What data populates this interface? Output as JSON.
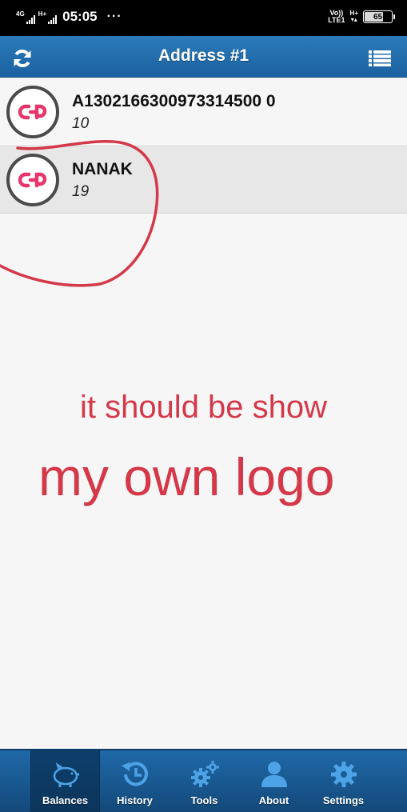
{
  "status_bar": {
    "network_1": "4G",
    "network_2": "H+",
    "time": "05:05",
    "more": "···",
    "volte_1": "Vo))",
    "volte_2": "LTE1",
    "data_type": "H+",
    "battery_percent": "65"
  },
  "header": {
    "title": "Address #1",
    "left_icon": "refresh-icon",
    "right_icon": "list-menu-icon"
  },
  "addresses": [
    {
      "address": "A1302166300973314500 0",
      "balance": "10",
      "logo": "coinpayments-logo"
    },
    {
      "address": "NANAK",
      "balance": "19",
      "logo": "coinpayments-logo"
    }
  ],
  "annotation": {
    "line1": "it should be show",
    "line2": "my own logo",
    "color": "#d43849"
  },
  "bottom_nav": [
    {
      "label": "Balances",
      "icon": "piggy-bank-icon",
      "active": true
    },
    {
      "label": "History",
      "icon": "history-icon",
      "active": false
    },
    {
      "label": "Tools",
      "icon": "gears-icon",
      "active": false
    },
    {
      "label": "About",
      "icon": "user-icon",
      "active": false
    },
    {
      "label": "Settings",
      "icon": "gear-icon",
      "active": false
    }
  ],
  "colors": {
    "header": "#1f6aaa",
    "logo_pink": "#e8366b",
    "tab_icon": "#4ea3e6"
  }
}
